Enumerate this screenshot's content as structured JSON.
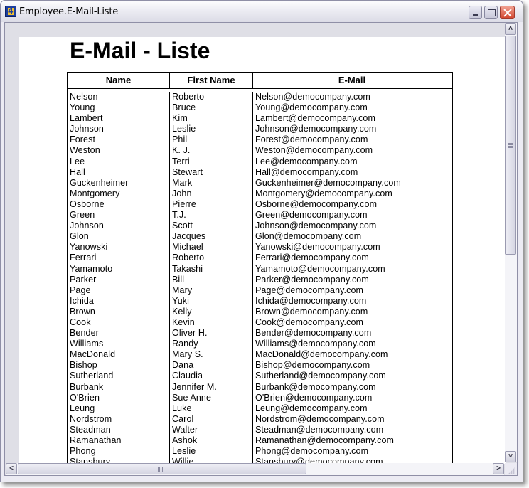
{
  "window": {
    "title": "Employee.E-Mail-Liste",
    "controls": {
      "minimize": "minimize",
      "maximize": "maximize",
      "close": "close"
    }
  },
  "report": {
    "title": "E-Mail - Liste",
    "columns": [
      "Name",
      "First Name",
      "E-Mail"
    ],
    "rows": [
      {
        "name": "Nelson",
        "first": "Roberto",
        "email": "Nelson@democompany.com"
      },
      {
        "name": "Young",
        "first": "Bruce",
        "email": "Young@democompany.com"
      },
      {
        "name": "Lambert",
        "first": "Kim",
        "email": "Lambert@democompany.com"
      },
      {
        "name": "Johnson",
        "first": "Leslie",
        "email": "Johnson@democompany.com"
      },
      {
        "name": "Forest",
        "first": "Phil",
        "email": "Forest@democompany.com"
      },
      {
        "name": "Weston",
        "first": "K. J.",
        "email": "Weston@democompany.com"
      },
      {
        "name": "Lee",
        "first": "Terri",
        "email": "Lee@democompany.com"
      },
      {
        "name": "Hall",
        "first": "Stewart",
        "email": "Hall@democompany.com"
      },
      {
        "name": "Guckenheimer",
        "first": "Mark",
        "email": "Guckenheimer@democompany.com"
      },
      {
        "name": "Montgomery",
        "first": "John",
        "email": "Montgomery@democompany.com"
      },
      {
        "name": "Osborne",
        "first": "Pierre",
        "email": "Osborne@democompany.com"
      },
      {
        "name": "Green",
        "first": "T.J.",
        "email": "Green@democompany.com"
      },
      {
        "name": "Johnson",
        "first": "Scott",
        "email": "Johnson@democompany.com"
      },
      {
        "name": "Glon",
        "first": "Jacques",
        "email": "Glon@democompany.com"
      },
      {
        "name": "Yanowski",
        "first": "Michael",
        "email": "Yanowski@democompany.com"
      },
      {
        "name": "Ferrari",
        "first": "Roberto",
        "email": "Ferrari@democompany.com"
      },
      {
        "name": "Yamamoto",
        "first": "Takashi",
        "email": "Yamamoto@democompany.com"
      },
      {
        "name": "Parker",
        "first": "Bill",
        "email": "Parker@democompany.com"
      },
      {
        "name": "Page",
        "first": "Mary",
        "email": "Page@democompany.com"
      },
      {
        "name": "Ichida",
        "first": "Yuki",
        "email": "Ichida@democompany.com"
      },
      {
        "name": "Brown",
        "first": "Kelly",
        "email": "Brown@democompany.com"
      },
      {
        "name": "Cook",
        "first": "Kevin",
        "email": "Cook@democompany.com"
      },
      {
        "name": "Bender",
        "first": "Oliver H.",
        "email": "Bender@democompany.com"
      },
      {
        "name": "Williams",
        "first": "Randy",
        "email": "Williams@democompany.com"
      },
      {
        "name": "MacDonald",
        "first": "Mary S.",
        "email": "MacDonald@democompany.com"
      },
      {
        "name": "Bishop",
        "first": "Dana",
        "email": "Bishop@democompany.com"
      },
      {
        "name": "Sutherland",
        "first": "Claudia",
        "email": "Sutherland@democompany.com"
      },
      {
        "name": "Burbank",
        "first": "Jennifer M.",
        "email": "Burbank@democompany.com"
      },
      {
        "name": "O'Brien",
        "first": "Sue Anne",
        "email": "O'Brien@democompany.com"
      },
      {
        "name": "Leung",
        "first": "Luke",
        "email": "Leung@democompany.com"
      },
      {
        "name": "Nordstrom",
        "first": "Carol",
        "email": "Nordstrom@democompany.com"
      },
      {
        "name": "Steadman",
        "first": "Walter",
        "email": "Steadman@democompany.com"
      },
      {
        "name": "Ramanathan",
        "first": "Ashok",
        "email": "Ramanathan@democompany.com"
      },
      {
        "name": "Phong",
        "first": "Leslie",
        "email": "Phong@democompany.com"
      },
      {
        "name": "Stansbury",
        "first": "Willie",
        "email": "Stansbury@democompany.com"
      }
    ]
  },
  "scrollbars": {
    "vertical": {
      "up_glyph": "˄",
      "down_glyph": "˅"
    },
    "horizontal": {
      "left_glyph": "<",
      "right_glyph": ">"
    }
  }
}
